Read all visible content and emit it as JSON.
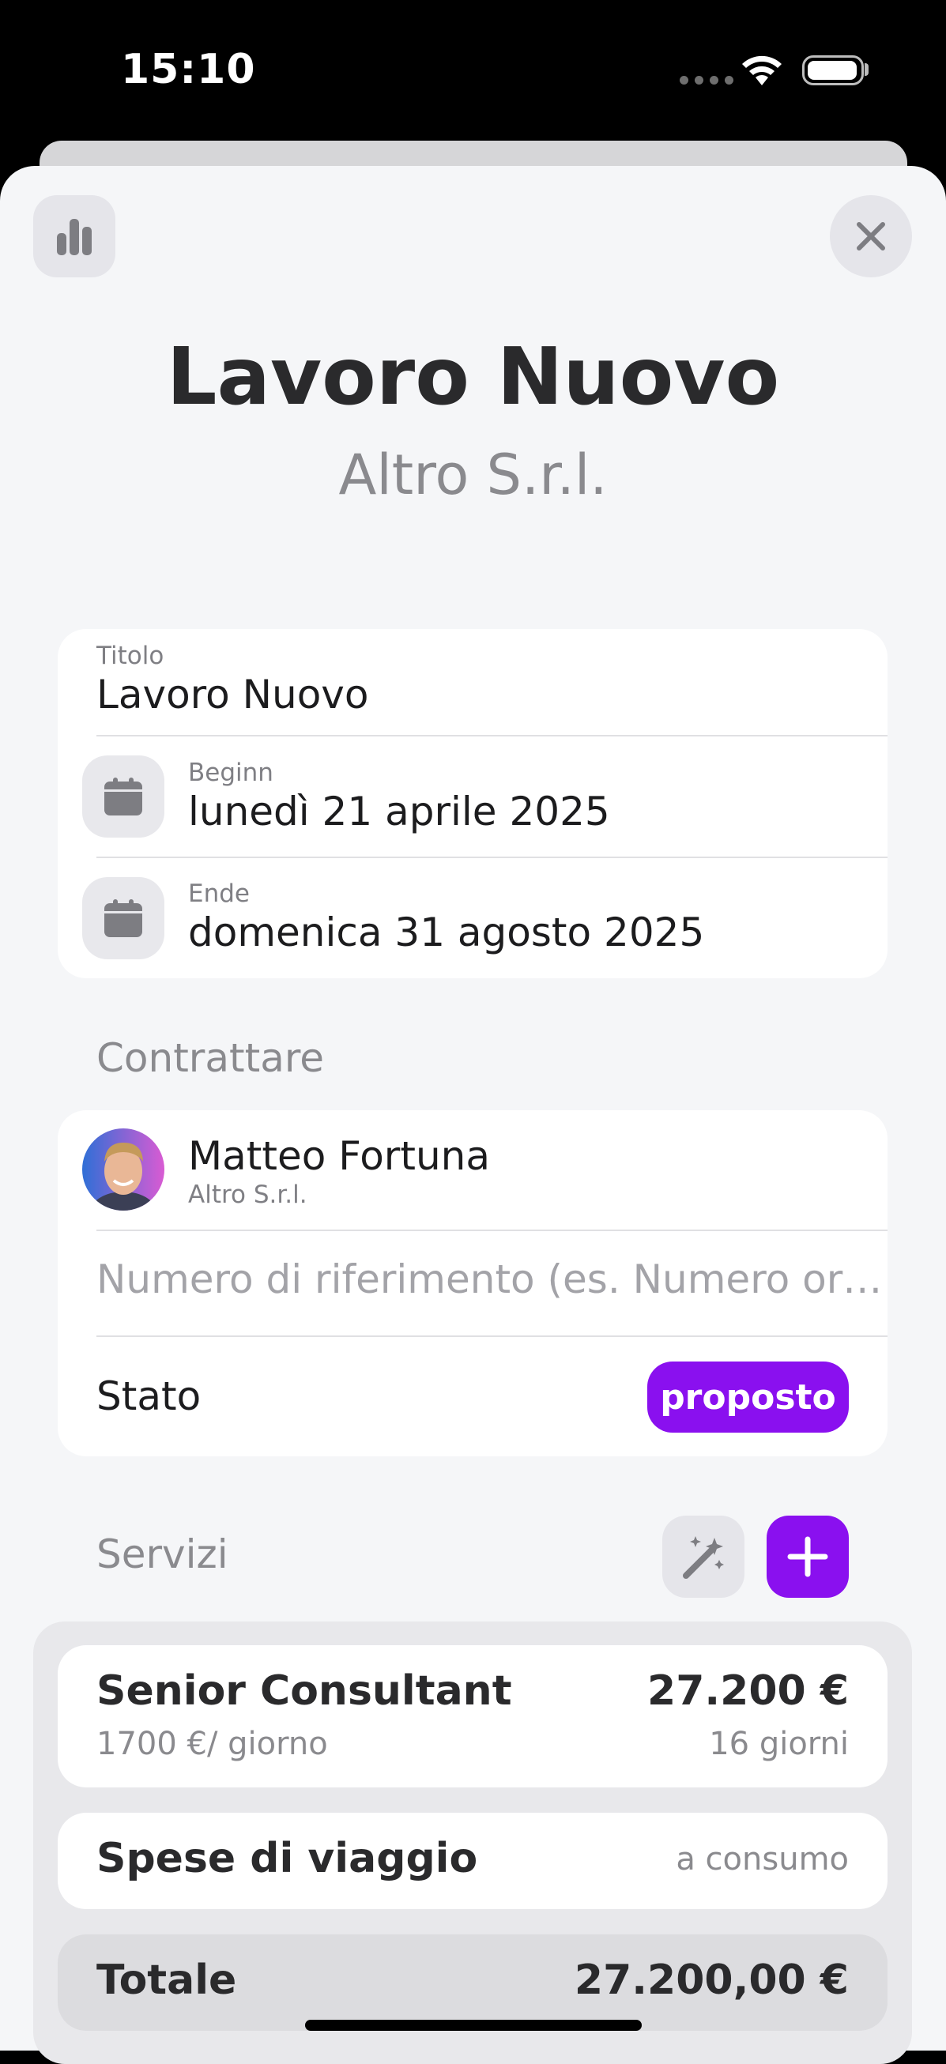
{
  "status_bar": {
    "time": "15:10"
  },
  "header": {
    "title": "Lavoro Nuovo",
    "subtitle": "Altro S.r.l."
  },
  "form": {
    "titolo_label": "Titolo",
    "titolo_value": "Lavoro Nuovo",
    "begin_label": "Beginn",
    "begin_value": "lunedì 21 aprile 2025",
    "end_label": "Ende",
    "end_value": "domenica 31 agosto 2025"
  },
  "contract": {
    "section_label": "Contrattare",
    "contact_name": "Matteo Fortuna",
    "contact_company": "Altro S.r.l.",
    "reference_placeholder": "Numero di riferimento (es. Numero or…",
    "status_label": "Stato",
    "status_value": "proposto"
  },
  "services": {
    "section_label": "Servizi",
    "items": [
      {
        "name": "Senior Consultant",
        "rate": "1700 €/ giorno",
        "amount": "27.200 €",
        "quantity": "16 giorni"
      },
      {
        "name": "Spese di viaggio",
        "amount": "a consumo"
      }
    ],
    "total_label": "Totale",
    "total_value": "27.200,00 €"
  },
  "colors": {
    "accent": "#8a10ef",
    "sheet_bg": "#f5f6f8"
  },
  "icons": [
    "chart-icon",
    "close-icon",
    "calendar-icon",
    "magic-wand-icon",
    "plus-icon",
    "wifi-icon",
    "battery-icon"
  ]
}
